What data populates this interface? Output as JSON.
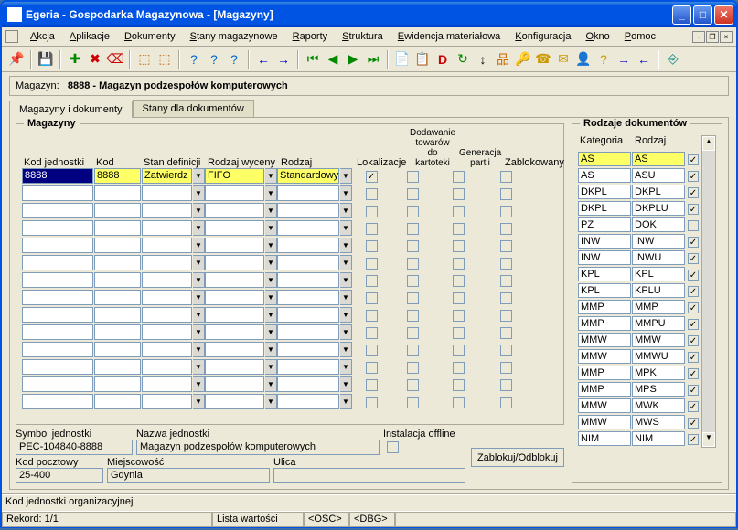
{
  "window": {
    "title": "Egeria - Gospodarka Magazynowa - [Magazyny]"
  },
  "menu": [
    "Akcja",
    "Aplikacje",
    "Dokumenty",
    "Stany magazynowe",
    "Raporty",
    "Struktura",
    "Ewidencja materiałowa",
    "Konfiguracja",
    "Okno",
    "Pomoc"
  ],
  "info": {
    "label": "Magazyn:",
    "value": "8888 - Magazyn podzespołów komputerowych"
  },
  "tabs": [
    "Magazyny i dokumenty",
    "Stany dla dokumentów"
  ],
  "mag": {
    "title": "Magazyny",
    "headers": {
      "kod_jedn": "Kod jednostki",
      "kod": "Kod",
      "stan": "Stan definicji",
      "rodzaj_w": "Rodzaj wyceny",
      "rodzaj": "Rodzaj",
      "lok": "Lokalizacje",
      "dod": "Dodawanie towarów do kartoteki",
      "gen": "Generacja partii",
      "zab": "Zablokowany"
    },
    "row": {
      "kod_jedn": "8888",
      "kod": "8888",
      "stan": "Zatwierdz",
      "rodzaj_w": "FIFO",
      "rodzaj": "Standardowy"
    }
  },
  "detail": {
    "symbol_l": "Symbol jednostki",
    "symbol_v": "PEC-104840-8888",
    "nazwa_l": "Nazwa jednostki",
    "nazwa_v": "Magazyn podzespołów komputerowych",
    "inst_l": "Instalacja offline",
    "btn": "Zablokuj/Odblokuj",
    "kod_l": "Kod pocztowy",
    "kod_v": "25-400",
    "miej_l": "Miejscowość",
    "miej_v": "Gdynia",
    "ulica_l": "Ulica",
    "ulica_v": ""
  },
  "rod": {
    "title": "Rodzaje dokumentów",
    "headers": {
      "kat": "Kategoria",
      "rodz": "Rodzaj"
    },
    "rows": [
      {
        "k": "AS",
        "r": "AS",
        "c": true,
        "sel": true
      },
      {
        "k": "AS",
        "r": "ASU",
        "c": true
      },
      {
        "k": "DKPL",
        "r": "DKPL",
        "c": true
      },
      {
        "k": "DKPL",
        "r": "DKPLU",
        "c": true
      },
      {
        "k": "PZ",
        "r": "DOK",
        "c": false
      },
      {
        "k": "INW",
        "r": "INW",
        "c": true
      },
      {
        "k": "INW",
        "r": "INWU",
        "c": true
      },
      {
        "k": "KPL",
        "r": "KPL",
        "c": true
      },
      {
        "k": "KPL",
        "r": "KPLU",
        "c": true
      },
      {
        "k": "MMP",
        "r": "MMP",
        "c": true
      },
      {
        "k": "MMP",
        "r": "MMPU",
        "c": true
      },
      {
        "k": "MMW",
        "r": "MMW",
        "c": true
      },
      {
        "k": "MMW",
        "r": "MMWU",
        "c": true
      },
      {
        "k": "MMP",
        "r": "MPK",
        "c": true
      },
      {
        "k": "MMP",
        "r": "MPS",
        "c": true
      },
      {
        "k": "MMW",
        "r": "MWK",
        "c": true
      },
      {
        "k": "MMW",
        "r": "MWS",
        "c": true
      },
      {
        "k": "NIM",
        "r": "NIM",
        "c": true
      }
    ]
  },
  "status": {
    "line1": "Kod jednostki organizacyjnej",
    "rekord": "Rekord: 1/1",
    "lista": "Lista wartości",
    "osc": "<OSC>",
    "dbg": "<DBG>"
  }
}
